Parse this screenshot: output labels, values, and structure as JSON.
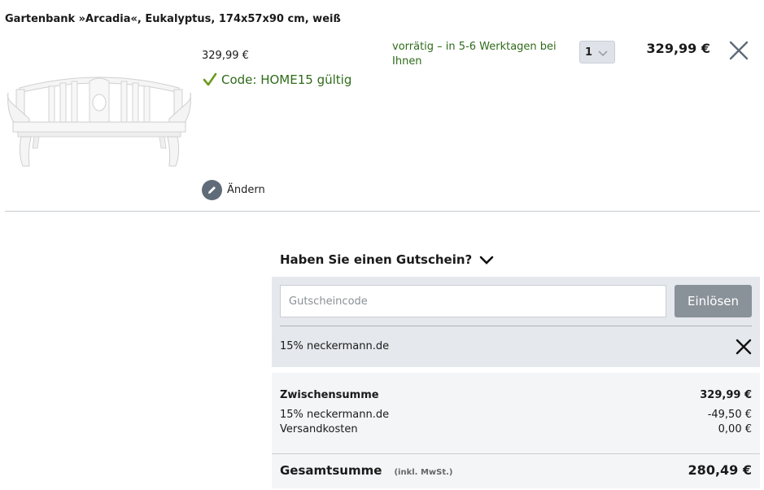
{
  "product": {
    "title": "Gartenbank »Arcadia«, Eukalyptus, 174x57x90 cm, weiß",
    "unit_price": "329,99 €",
    "code_status": "Code: HOME15 gültig",
    "availability": "vorrätig – in 5-6 Werktagen bei Ihnen",
    "quantity": "1",
    "line_total": "329,99 €",
    "edit_label": "Ändern"
  },
  "voucher": {
    "toggle_label": "Haben Sie einen Gutschein?",
    "input_placeholder": "Gutscheincode",
    "input_value": "",
    "redeem_label": "Einlösen",
    "applied_label": "15% neckermann.de"
  },
  "summary": {
    "subtotal_label": "Zwischensumme",
    "subtotal_value": "329,99 €",
    "discount_label": "15% neckermann.de",
    "discount_value": "-49,50 €",
    "shipping_label": "Versandkosten",
    "shipping_value": "0,00 €",
    "total_label": "Gesamtsumme",
    "total_note": "(inkl. MwSt.)",
    "total_value": "280,49 €"
  },
  "colors": {
    "success_green": "#2f6b1a",
    "panel_gray": "#e5e8ec",
    "button_gray": "#8a9299"
  },
  "icons": {
    "check": "check-icon",
    "remove": "close-icon",
    "edit": "pencil-icon",
    "expand": "chevron-down-icon"
  }
}
